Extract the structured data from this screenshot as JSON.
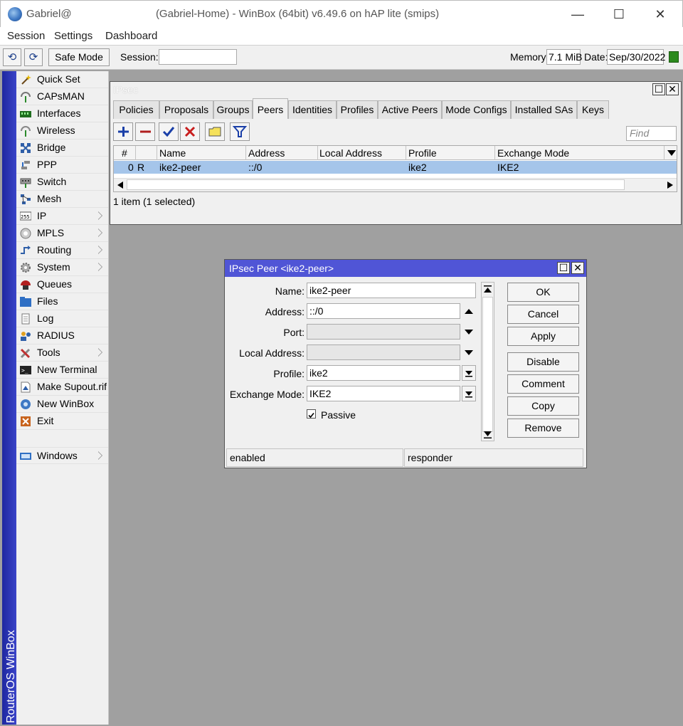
{
  "window": {
    "title_prefix": "Gabriel@",
    "title_suffix": "(Gabriel-Home) - WinBox (64bit) v6.49.6 on hAP lite (smips)",
    "minimize": "—",
    "maximize": "☐",
    "close": "✕"
  },
  "menu": [
    "Session",
    "Settings",
    "Dashboard"
  ],
  "toolbar": {
    "undo": "⟲",
    "redo": "⟳",
    "safe_mode": "Safe Mode",
    "session_label": "Session:",
    "session_value": "",
    "memory_label": "Memory:",
    "memory_value": "7.1 MiB",
    "date_label": "Date:",
    "date_value": "Sep/30/2022"
  },
  "brand_vertical": "RouterOS WinBox",
  "sidebar": [
    {
      "label": "Quick Set",
      "icon": "wand-icon",
      "submenu": false
    },
    {
      "label": "CAPsMAN",
      "icon": "antenna-icon",
      "submenu": false
    },
    {
      "label": "Interfaces",
      "icon": "interfaces-icon",
      "submenu": false
    },
    {
      "label": "Wireless",
      "icon": "wireless-icon",
      "submenu": false
    },
    {
      "label": "Bridge",
      "icon": "bridge-icon",
      "submenu": false
    },
    {
      "label": "PPP",
      "icon": "ppp-icon",
      "submenu": false
    },
    {
      "label": "Switch",
      "icon": "switch-icon",
      "submenu": false
    },
    {
      "label": "Mesh",
      "icon": "mesh-icon",
      "submenu": false
    },
    {
      "label": "IP",
      "icon": "ip-icon",
      "submenu": true
    },
    {
      "label": "MPLS",
      "icon": "mpls-icon",
      "submenu": true
    },
    {
      "label": "Routing",
      "icon": "routing-icon",
      "submenu": true
    },
    {
      "label": "System",
      "icon": "gear-icon",
      "submenu": true
    },
    {
      "label": "Queues",
      "icon": "queues-icon",
      "submenu": false
    },
    {
      "label": "Files",
      "icon": "folder-icon",
      "submenu": false
    },
    {
      "label": "Log",
      "icon": "log-icon",
      "submenu": false
    },
    {
      "label": "RADIUS",
      "icon": "radius-icon",
      "submenu": false
    },
    {
      "label": "Tools",
      "icon": "tools-icon",
      "submenu": true
    },
    {
      "label": "New Terminal",
      "icon": "terminal-icon",
      "submenu": false
    },
    {
      "label": "Make Supout.rif",
      "icon": "supout-icon",
      "submenu": false
    },
    {
      "label": "New WinBox",
      "icon": "winbox-icon",
      "submenu": false
    },
    {
      "label": "Exit",
      "icon": "exit-icon",
      "submenu": false
    },
    {
      "label": "Windows",
      "icon": "windows-icon",
      "submenu": true
    }
  ],
  "ipsec": {
    "title": "IPsec",
    "tabs": [
      "Policies",
      "Proposals",
      "Groups",
      "Peers",
      "Identities",
      "Profiles",
      "Active Peers",
      "Mode Configs",
      "Installed SAs",
      "Keys"
    ],
    "active_tab": "Peers",
    "find_placeholder": "Find",
    "columns": [
      "#",
      "Name",
      "Address",
      "Local Address",
      "Profile",
      "Exchange Mode"
    ],
    "rows": [
      {
        "num": "0",
        "flag": "R",
        "name": "ike2-peer",
        "address": "::/0",
        "local_address": "",
        "profile": "ike2",
        "exchange_mode": "IKE2"
      }
    ],
    "status": "1 item (1 selected)",
    "colors": {
      "selected_row": "#a5c5ea"
    }
  },
  "peer_dialog": {
    "title": "IPsec Peer <ike2-peer>",
    "fields": {
      "name_label": "Name:",
      "name_value": "ike2-peer",
      "address_label": "Address:",
      "address_value": "::/0",
      "port_label": "Port:",
      "port_value": "",
      "local_address_label": "Local Address:",
      "local_address_value": "",
      "profile_label": "Profile:",
      "profile_value": "ike2",
      "exchange_mode_label": "Exchange Mode:",
      "exchange_mode_value": "IKE2",
      "passive_label": "Passive",
      "passive_checked": true
    },
    "buttons": [
      "OK",
      "Cancel",
      "Apply",
      "Disable",
      "Comment",
      "Copy",
      "Remove"
    ],
    "status_left": "enabled",
    "status_right": "responder",
    "colors": {
      "title_bar": "#5055d6"
    }
  }
}
